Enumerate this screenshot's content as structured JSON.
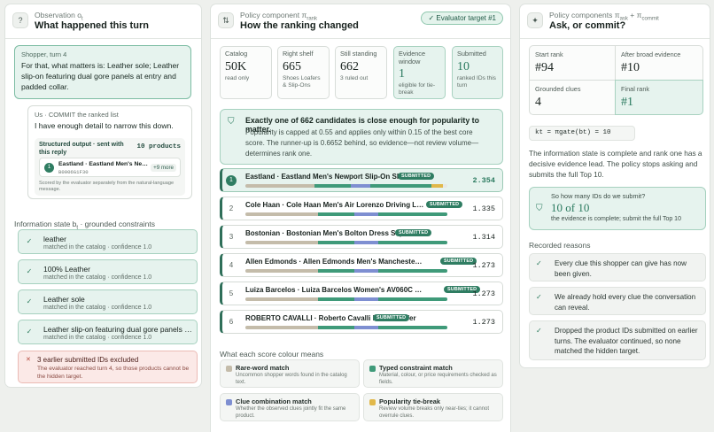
{
  "observation": {
    "small_label": "Observation o",
    "small_sub": "t",
    "title": "What happened this turn",
    "icon": "question-icon",
    "shopper_label": "Shopper, turn 4",
    "shopper_text": "For that, what matters is: Leather sole; Leather slip-on featuring dual gore panels at entry and padded collar.",
    "us_label": "Us · COMMIT the ranked list",
    "us_text": "I have enough detail to narrow this down.",
    "structured_heading": "Structured output · sent with this reply",
    "structured_count": "10 products",
    "product_rank": "1",
    "product_name": "Eastland · Eastland Men's Newport Slip-On Shoe",
    "product_id": "B0006G1F30",
    "more": "+9 more",
    "footnote": "Scored by the evaluator separately from the natural-language message.",
    "info_label_prefix": "Information state b",
    "info_label_sub": "t",
    "info_label_suffix": " · grounded constraints",
    "clues": [
      {
        "text": "leather",
        "sub": "matched in the catalog · confidence 1.0"
      },
      {
        "text": "100% Leather",
        "sub": "matched in the catalog · confidence 1.0"
      },
      {
        "text": "Leather sole",
        "sub": "matched in the catalog · confidence 1.0"
      },
      {
        "text": "Leather slip-on featuring dual gore panels at entry and padded collar",
        "sub": "matched in the catalog · confidence 1.0"
      }
    ],
    "excluded_title": "3 earlier submitted IDs excluded",
    "excluded_sub": "The evaluator reached turn 4, so those products cannot be the hidden target."
  },
  "policy": {
    "small_label": "Policy component π",
    "small_sub": "rank",
    "title": "How the ranking changed",
    "icon": "arrows-icon",
    "badge": "Evaluator target #1",
    "metrics": [
      {
        "label": "Catalog",
        "value": "50K",
        "sub": "read only"
      },
      {
        "label": "Right shelf",
        "value": "665",
        "sub": "Shoes Loafers & Slip-Ons"
      },
      {
        "label": "Still standing",
        "value": "662",
        "sub": "3 ruled out"
      },
      {
        "label": "Evidence window",
        "value": "1",
        "sub": "eligible for tie-break"
      },
      {
        "label": "Submitted",
        "value": "10",
        "sub": "ranked IDs this turn"
      }
    ],
    "callout_title": "Exactly one of 662 candidates is close enough for popularity to matter.",
    "callout_body": "Popularity is capped at 0.55 and applies only within 0.15 of the best core score. The runner-up is 0.6652 behind, so evidence—not review volume—determines rank one.",
    "submitted_badge": "SUBMITTED",
    "rows": [
      {
        "rank": "1",
        "name": "Eastland · Eastland Men's Newport Slip-On Shoe",
        "score": "2.354",
        "segments": [
          0.34,
          0.18,
          0.1,
          0.3,
          0.06
        ]
      },
      {
        "rank": "2",
        "name": "Cole Haan · Cole Haan Men's Air Lorenzo Driving Loafer",
        "score": "1.335",
        "segments": [
          0.36,
          0.18,
          0.12,
          0.34,
          0
        ]
      },
      {
        "rank": "3",
        "name": "Bostonian · Bostonian Men's Bolton Dress Slip-On",
        "score": "1.314",
        "segments": [
          0.36,
          0.18,
          0.12,
          0.34,
          0
        ]
      },
      {
        "rank": "4",
        "name": "Allen Edmonds · Allen Edmonds Men's Manchester Wing Tip Slip-On",
        "score": "1.273",
        "segments": [
          0.36,
          0.18,
          0.12,
          0.34,
          0
        ]
      },
      {
        "rank": "5",
        "name": "Luiza Barcelos · Luiza Barcelos Women's AV060C Slip-On Loafer",
        "score": "1.273",
        "segments": [
          0.36,
          0.18,
          0.12,
          0.34,
          0
        ]
      },
      {
        "rank": "6",
        "name": "ROBERTO CAVALLI · Roberto Cavalli Men's Loafer",
        "score": "1.273",
        "segments": [
          0.36,
          0.18,
          0.12,
          0.34,
          0
        ]
      }
    ],
    "legend_title": "What each score colour means",
    "legend": [
      {
        "title": "Rare-word match",
        "sub": "Uncommon shopper words found in the catalog text.",
        "color": "#c4bcaa"
      },
      {
        "title": "Typed constraint match",
        "sub": "Material, colour, or price requirements checked as fields.",
        "color": "#3f9a79"
      },
      {
        "title": "Clue combination match",
        "sub": "Whether the observed clues jointly fit the same product.",
        "color": "#7e8fd1"
      },
      {
        "title": "Popularity tie-break",
        "sub": "Review volume breaks only near-ties; it cannot overrule clues.",
        "color": "#e1b84a"
      }
    ]
  },
  "decision": {
    "small_label": "Policy components π",
    "small_sub1": "ask",
    "small_mid": " + π",
    "small_sub2": "commit",
    "title": "Ask, or commit?",
    "icon": "sparkle-icon",
    "cells": [
      {
        "label": "Start rank",
        "value": "#94"
      },
      {
        "label": "After broad evidence",
        "value": "#10"
      },
      {
        "label": "Grounded clues",
        "value": "4"
      },
      {
        "label": "Final rank",
        "value": "#1"
      }
    ],
    "formula": "kt = πgate(bt) = 10",
    "paragraph": "The information state is complete and rank one has a decisive evidence lead. The policy stops asking and submits the full Top 10.",
    "submit_q": "So how many IDs do we submit?",
    "submit_v": "10 of 10",
    "submit_s": "the evidence is complete; submit the full Top 10",
    "reasons_label": "Recorded reasons",
    "reasons": [
      "Every clue this shopper can give has now been given.",
      "We already hold every clue the conversation can reveal.",
      "Dropped the product IDs submitted on earlier turns. The evaluator continued, so none matched the hidden target."
    ]
  },
  "colors": {
    "accent": "#2f7d62",
    "panel_green": "#e6f3ee",
    "seg_rare": "#c4bcaa",
    "seg_typed": "#3f9a79",
    "seg_combo": "#7e8fd1",
    "seg_pop": "#e1b84a"
  }
}
